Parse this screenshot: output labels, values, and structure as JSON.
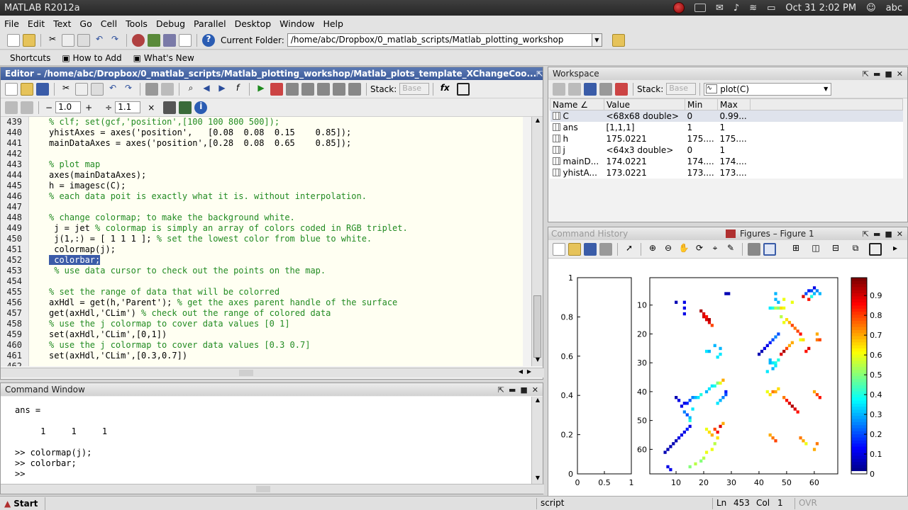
{
  "app_title": "MATLAB  R2012a",
  "system_tray": {
    "datetime": "Oct 31  2:02 PM",
    "user": "abc"
  },
  "menu": [
    "File",
    "Edit",
    "Text",
    "Go",
    "Cell",
    "Tools",
    "Debug",
    "Parallel",
    "Desktop",
    "Window",
    "Help"
  ],
  "toolbar": {
    "current_folder_label": "Current Folder:",
    "current_folder_value": "/home/abc/Dropbox/0_matlab_scripts/Matlab_plotting_workshop"
  },
  "shortcuts": {
    "shortcuts": "Shortcuts",
    "how_to_add": "How to Add",
    "whats_new": "What's New"
  },
  "editor": {
    "title": "Editor – /home/abc/Dropbox/0_matlab_scripts/Matlab_plotting_workshop/Matlab_plots_template_XChangeCoo...",
    "stack_label": "Stack:",
    "stack_value": "Base",
    "zoom1_minus": "−",
    "zoom1_value": "1.0",
    "zoom1_plus": "+",
    "zoom2_div": "÷",
    "zoom2_value": "1.1",
    "zoom2_x": "×",
    "lines": [
      {
        "n": "439",
        "text": "% clf; set(gcf,'position',[100 100 800 500]);",
        "kind": "comment"
      },
      {
        "n": "440",
        "text": "yhistAxes = axes('position',   [0.08  0.08  0.15    0.85]);",
        "kind": "code"
      },
      {
        "n": "441",
        "text": "mainDataAxes = axes('position',[0.28  0.08  0.65    0.85]);",
        "kind": "code"
      },
      {
        "n": "442",
        "text": "",
        "kind": "code"
      },
      {
        "n": "443",
        "text": "% plot map",
        "kind": "comment"
      },
      {
        "n": "444",
        "text": "axes(mainDataAxes);",
        "kind": "code"
      },
      {
        "n": "445",
        "text": "h = imagesc(C);",
        "kind": "code"
      },
      {
        "n": "446",
        "text": "% each data poit is exactly what it is. without interpolation.",
        "kind": "comment"
      },
      {
        "n": "447",
        "text": "",
        "kind": "code"
      },
      {
        "n": "448",
        "text": "% change colormap; to make the background white.",
        "kind": "comment"
      },
      {
        "n": "449",
        "text": " j = jet % colormap is simply an array of colors coded in RGB triplet.",
        "kind": "mixed",
        "code": " j = jet ",
        "cmt": "% colormap is simply an array of colors coded in RGB triplet."
      },
      {
        "n": "450",
        "text": " j(1,:) = [ 1 1 1 ]; % set the lowest color from blue to white.",
        "kind": "mixed",
        "code": " j(1,:) = [ 1 1 1 ]; ",
        "cmt": "% set the lowest color from blue to white."
      },
      {
        "n": "451",
        "text": " colormap(j);",
        "kind": "code"
      },
      {
        "n": "452",
        "text": " colorbar;",
        "kind": "selected"
      },
      {
        "n": "453",
        "text": " % use data cursor to check out the points on the map.",
        "kind": "comment"
      },
      {
        "n": "454",
        "text": "",
        "kind": "code"
      },
      {
        "n": "455",
        "text": "% set the range of data that will be colorred",
        "kind": "comment"
      },
      {
        "n": "456",
        "text": "axHdl = get(h,'Parent'); % get the axes parent handle of the surface",
        "kind": "mixed",
        "code": "axHdl = get(h,'Parent'); ",
        "cmt": "% get the axes parent handle of the surface"
      },
      {
        "n": "457",
        "text": "get(axHdl,'CLim') % check out the range of colored data",
        "kind": "mixed",
        "code": "get(axHdl,'CLim') ",
        "cmt": "% check out the range of colored data"
      },
      {
        "n": "458",
        "text": "% use the j colormap to cover data values [0 1]",
        "kind": "comment"
      },
      {
        "n": "459",
        "text": "set(axHdl,'CLim',[0,1])",
        "kind": "code"
      },
      {
        "n": "460",
        "text": "% use the j colormap to cover data values [0.3 0.7]",
        "kind": "comment"
      },
      {
        "n": "461",
        "text": "set(axHdl,'CLim',[0.3,0.7])",
        "kind": "code"
      },
      {
        "n": "462",
        "text": "",
        "kind": "code"
      }
    ]
  },
  "workspace": {
    "title": "Workspace",
    "stack_label": "Stack:",
    "stack_value": "Base",
    "plot_select": "plot(C)",
    "columns": [
      "Name ∠",
      "Value",
      "Min",
      "Max"
    ],
    "rows": [
      {
        "name": "C",
        "value": "<68x68 double>",
        "min": "0",
        "max": "0.99..."
      },
      {
        "name": "ans",
        "value": "[1,1,1]",
        "min": "1",
        "max": "1"
      },
      {
        "name": "h",
        "value": "175.0221",
        "min": "175....",
        "max": "175...."
      },
      {
        "name": "j",
        "value": "<64x3 double>",
        "min": "0",
        "max": "1"
      },
      {
        "name": "mainD...",
        "value": "174.0221",
        "min": "174....",
        "max": "174...."
      },
      {
        "name": "yhistA...",
        "value": "173.0221",
        "min": "173....",
        "max": "173...."
      }
    ]
  },
  "figure": {
    "history_tab": "Command History",
    "title": "Figures – Figure 1"
  },
  "chart_data": [
    {
      "type": "line",
      "title": "",
      "xlim": [
        0,
        1
      ],
      "ylim": [
        0,
        1
      ],
      "x_ticks": [
        "0",
        "0.5",
        "1"
      ],
      "y_ticks": [
        "0",
        "0.2",
        "0.4",
        "0.6",
        "0.8",
        "1"
      ],
      "series": []
    },
    {
      "type": "heatmap",
      "title": "",
      "xlim": [
        0.5,
        68.5
      ],
      "ylim": [
        0.5,
        68.5
      ],
      "x_ticks": [
        "10",
        "20",
        "30",
        "40",
        "50",
        "60"
      ],
      "y_ticks": [
        "10",
        "20",
        "30",
        "40",
        "50",
        "60"
      ],
      "colorbar_ticks": [
        "0",
        "0.1",
        "0.2",
        "0.3",
        "0.4",
        "0.5",
        "0.6",
        "0.7",
        "0.8",
        "0.9"
      ],
      "clim": [
        0,
        0.99
      ],
      "cells": [
        [
          28,
          6,
          0.05
        ],
        [
          29,
          6,
          0.05
        ],
        [
          10,
          9,
          0.05
        ],
        [
          13,
          9,
          0.1
        ],
        [
          13,
          11,
          0.1
        ],
        [
          13,
          13,
          0.1
        ],
        [
          19,
          12,
          0.95
        ],
        [
          20,
          13,
          0.9
        ],
        [
          20,
          14,
          0.9
        ],
        [
          21,
          14,
          0.85
        ],
        [
          21,
          15,
          0.9
        ],
        [
          22,
          15,
          0.95
        ],
        [
          22,
          16,
          0.9
        ],
        [
          23,
          17,
          0.8
        ],
        [
          46,
          6,
          0.3
        ],
        [
          46,
          8,
          0.3
        ],
        [
          44,
          11,
          0.35
        ],
        [
          45,
          11,
          0.4
        ],
        [
          46,
          11,
          0.55
        ],
        [
          47,
          11,
          0.5
        ],
        [
          48,
          11,
          0.65
        ],
        [
          49,
          11,
          0.6
        ],
        [
          48,
          14,
          0.55
        ],
        [
          49,
          16,
          0.6
        ],
        [
          50,
          15,
          0.65
        ],
        [
          51,
          16,
          0.7
        ],
        [
          52,
          17,
          0.8
        ],
        [
          53,
          18,
          0.75
        ],
        [
          54,
          19,
          0.8
        ],
        [
          55,
          20,
          0.85
        ],
        [
          47,
          9,
          0.3
        ],
        [
          49,
          8,
          0.6
        ],
        [
          52,
          9,
          0.6
        ],
        [
          56,
          7,
          0.9
        ],
        [
          57,
          6,
          0.2
        ],
        [
          58,
          5,
          0.15
        ],
        [
          59,
          5,
          0.2
        ],
        [
          60,
          4,
          0.1
        ],
        [
          58,
          8,
          0.85
        ],
        [
          59,
          7,
          0.4
        ],
        [
          60,
          6,
          0.3
        ],
        [
          61,
          5,
          0.25
        ],
        [
          62,
          6,
          0.3
        ],
        [
          40,
          27,
          0.05
        ],
        [
          41,
          26,
          0.05
        ],
        [
          42,
          25,
          0.1
        ],
        [
          43,
          24,
          0.1
        ],
        [
          44,
          23,
          0.15
        ],
        [
          45,
          22,
          0.2
        ],
        [
          46,
          21,
          0.25
        ],
        [
          47,
          20,
          0.2
        ],
        [
          48,
          27,
          0.9
        ],
        [
          49,
          26,
          0.95
        ],
        [
          50,
          25,
          0.8
        ],
        [
          51,
          24,
          0.7
        ],
        [
          52,
          23,
          0.7
        ],
        [
          57,
          26,
          0.85
        ],
        [
          58,
          25,
          0.9
        ],
        [
          55,
          22,
          0.6
        ],
        [
          56,
          22,
          0.65
        ],
        [
          61,
          20,
          0.7
        ],
        [
          61,
          22,
          0.75
        ],
        [
          62,
          22,
          0.8
        ],
        [
          44,
          30,
          0.3
        ],
        [
          45,
          30,
          0.35
        ],
        [
          46,
          30,
          0.4
        ],
        [
          44,
          29,
          0.3
        ],
        [
          45,
          32,
          0.3
        ],
        [
          46,
          31,
          0.35
        ],
        [
          47,
          29,
          0.4
        ],
        [
          43,
          33,
          0.35
        ],
        [
          21,
          26,
          0.35
        ],
        [
          22,
          26,
          0.3
        ],
        [
          26,
          27,
          0.35
        ],
        [
          26,
          25,
          0.3
        ],
        [
          24,
          24,
          0.3
        ],
        [
          25,
          28,
          0.35
        ],
        [
          6,
          61,
          0.05
        ],
        [
          7,
          60,
          0.05
        ],
        [
          8,
          59,
          0.05
        ],
        [
          9,
          58,
          0.05
        ],
        [
          10,
          57,
          0.05
        ],
        [
          11,
          56,
          0.1
        ],
        [
          12,
          55,
          0.1
        ],
        [
          13,
          54,
          0.1
        ],
        [
          14,
          53,
          0.15
        ],
        [
          15,
          52,
          0.1
        ],
        [
          10,
          42,
          0.05
        ],
        [
          11,
          43,
          0.1
        ],
        [
          12,
          45,
          0.1
        ],
        [
          13,
          44,
          0.1
        ],
        [
          14,
          44,
          0.15
        ],
        [
          15,
          43,
          0.2
        ],
        [
          16,
          42,
          0.25
        ],
        [
          17,
          42,
          0.3
        ],
        [
          18,
          42,
          0.35
        ],
        [
          19,
          41,
          0.4
        ],
        [
          21,
          40,
          0.3
        ],
        [
          22,
          39,
          0.35
        ],
        [
          23,
          38,
          0.35
        ],
        [
          24,
          38,
          0.4
        ],
        [
          25,
          37,
          0.5
        ],
        [
          26,
          37,
          0.6
        ],
        [
          27,
          36,
          0.7
        ],
        [
          28,
          40,
          0.15
        ],
        [
          28,
          41,
          0.2
        ],
        [
          27,
          42,
          0.25
        ],
        [
          26,
          43,
          0.3
        ],
        [
          25,
          44,
          0.35
        ],
        [
          43,
          40,
          0.6
        ],
        [
          44,
          41,
          0.65
        ],
        [
          45,
          40,
          0.75
        ],
        [
          46,
          40,
          0.7
        ],
        [
          47,
          39,
          0.65
        ],
        [
          49,
          42,
          0.75
        ],
        [
          50,
          43,
          0.85
        ],
        [
          51,
          44,
          0.9
        ],
        [
          52,
          45,
          0.95
        ],
        [
          53,
          46,
          0.9
        ],
        [
          54,
          47,
          0.85
        ],
        [
          60,
          40,
          0.7
        ],
        [
          61,
          41,
          0.8
        ],
        [
          62,
          42,
          0.85
        ],
        [
          13,
          47,
          0.25
        ],
        [
          14,
          48,
          0.2
        ],
        [
          15,
          49,
          0.3
        ],
        [
          15,
          50,
          0.4
        ],
        [
          16,
          46,
          0.35
        ],
        [
          21,
          53,
          0.6
        ],
        [
          22,
          54,
          0.65
        ],
        [
          23,
          55,
          0.7
        ],
        [
          24,
          53,
          0.8
        ],
        [
          25,
          54,
          0.85
        ],
        [
          26,
          52,
          0.9
        ],
        [
          27,
          51,
          0.7
        ],
        [
          23,
          60,
          0.6
        ],
        [
          24,
          58,
          0.55
        ],
        [
          25,
          56,
          0.65
        ],
        [
          21,
          61,
          0.6
        ],
        [
          20,
          63,
          0.55
        ],
        [
          19,
          64,
          0.5
        ],
        [
          17,
          65,
          0.55
        ],
        [
          15,
          66,
          0.5
        ],
        [
          7,
          66,
          0.1
        ],
        [
          8,
          67,
          0.1
        ],
        [
          44,
          55,
          0.7
        ],
        [
          45,
          56,
          0.75
        ],
        [
          46,
          57,
          0.8
        ],
        [
          55,
          56,
          0.75
        ],
        [
          56,
          57,
          0.7
        ],
        [
          57,
          58,
          0.6
        ],
        [
          60,
          60,
          0.7
        ],
        [
          61,
          58,
          0.75
        ]
      ]
    }
  ],
  "command_window": {
    "title": "Command Window",
    "lines": [
      "ans =",
      "",
      "     1     1     1",
      "",
      ">> colormap(j);",
      ">> colorbar;",
      ">> "
    ]
  },
  "status": {
    "start": "Start",
    "mode": "script",
    "ln_label": "Ln",
    "ln_value": "453",
    "col_label": "Col",
    "col_value": "1",
    "ovr": "OVR"
  },
  "colors": {
    "title_blue": "#3b5a9b",
    "selection": "#3b5ba8",
    "comment": "#228b22",
    "string": "#a020f0"
  }
}
